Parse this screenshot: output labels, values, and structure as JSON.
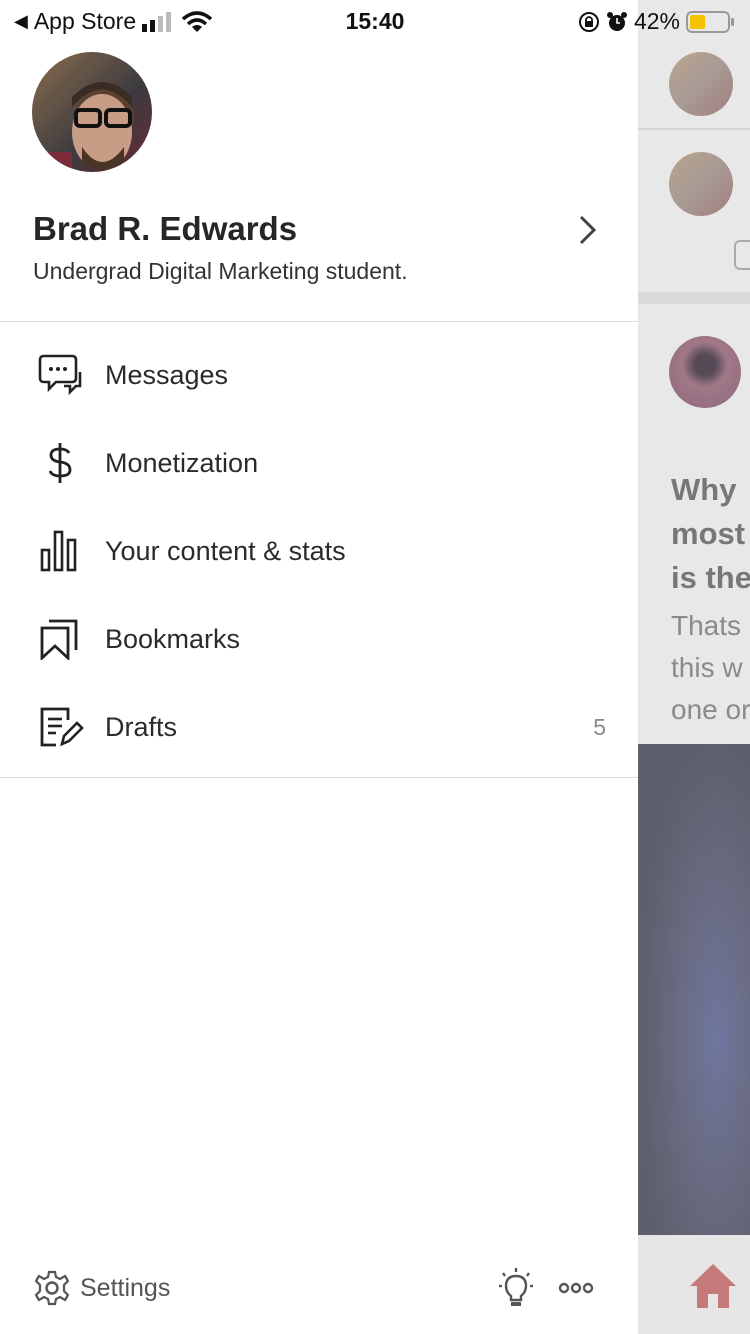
{
  "status_bar": {
    "back_app": "App Store",
    "time": "15:40",
    "battery": "42%",
    "battery_level": 0.42,
    "battery_color": "#f5c400"
  },
  "profile": {
    "name": "Brad R. Edwards",
    "bio": "Undergrad Digital Marketing student."
  },
  "menu": [
    {
      "label": "Messages",
      "icon": "chat-bubbles-icon"
    },
    {
      "label": "Monetization",
      "icon": "dollar-icon"
    },
    {
      "label": "Your content & stats",
      "icon": "bar-chart-icon"
    },
    {
      "label": "Bookmarks",
      "icon": "bookmarks-icon"
    },
    {
      "label": "Drafts",
      "icon": "drafts-icon",
      "count": "5"
    }
  ],
  "footer": {
    "settings": "Settings"
  },
  "background": {
    "headline": [
      "Why",
      "most",
      "is the"
    ],
    "snippet": [
      "Thats",
      "this w",
      "one or"
    ],
    "home_color": "#c47a78"
  }
}
